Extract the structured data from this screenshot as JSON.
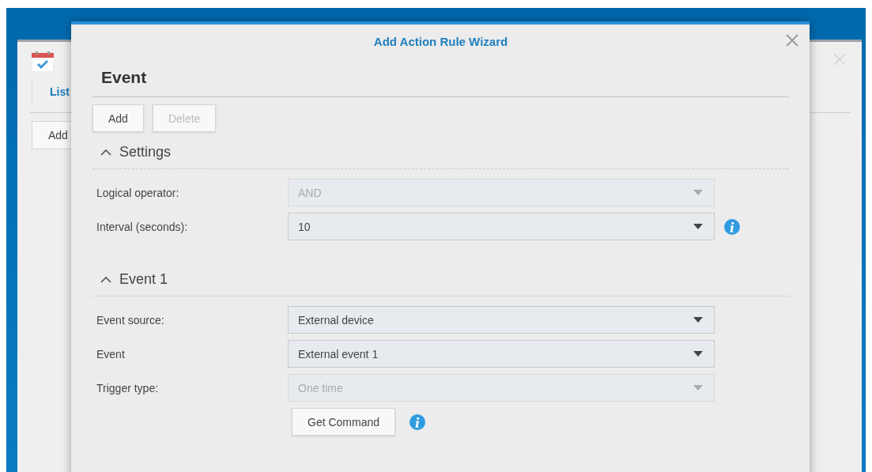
{
  "background_window": {
    "tab": {
      "label": "List",
      "selected": true
    },
    "button": "Add"
  },
  "dialog": {
    "title": "Add Action Rule Wizard",
    "heading": "Event",
    "toolbar": [
      {
        "label": "Add",
        "disabled": false
      },
      {
        "label": "Delete",
        "disabled": true
      }
    ],
    "sections": [
      {
        "title": "Settings",
        "expanded": true,
        "fields": [
          {
            "label": "Logical operator:",
            "value": "AND",
            "disabled": true,
            "info": false
          },
          {
            "label": "Interval (seconds):",
            "value": "10",
            "disabled": false,
            "info": true
          }
        ]
      },
      {
        "title": "Event 1",
        "expanded": true,
        "fields": [
          {
            "label": "Event source:",
            "value": "External device",
            "disabled": false,
            "info": false
          },
          {
            "label": "Event",
            "value": "External event 1",
            "disabled": false,
            "info": false
          },
          {
            "label": "Trigger type:",
            "value": "One time",
            "disabled": true,
            "info": false
          }
        ],
        "command_button": "Get Command",
        "command_info": true
      }
    ]
  }
}
